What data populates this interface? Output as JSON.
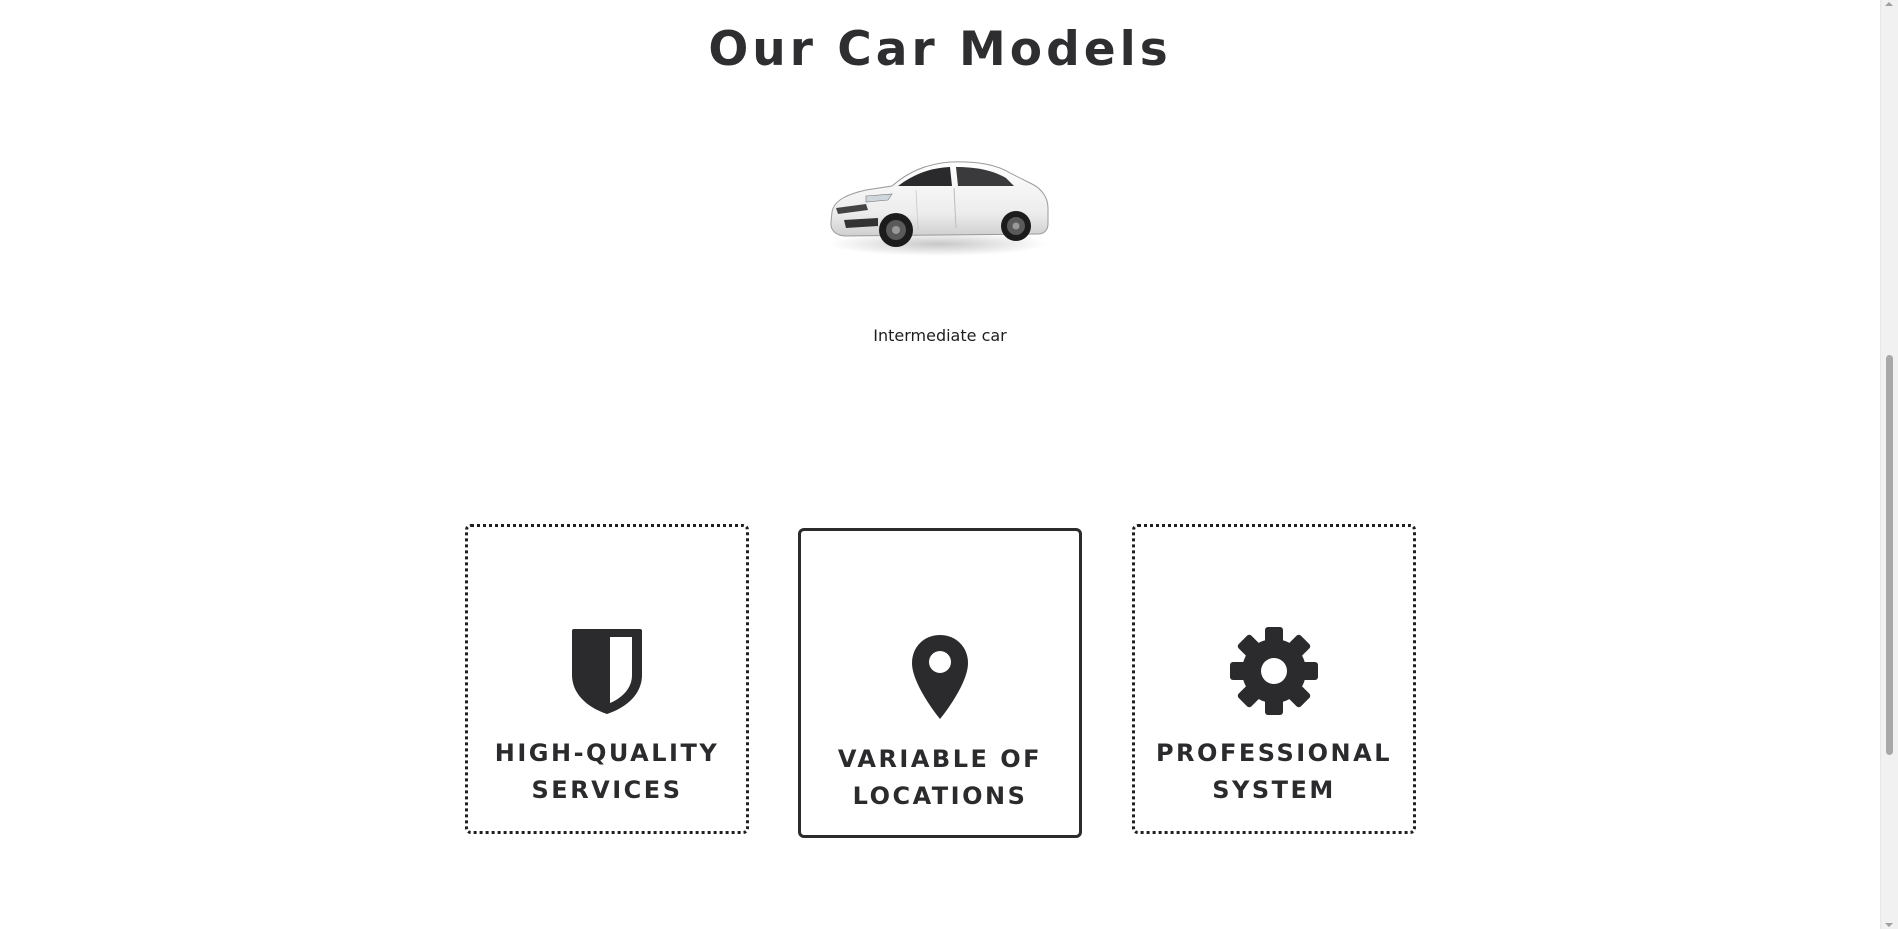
{
  "section": {
    "title": "Our Car Models"
  },
  "car": {
    "caption": "Intermediate car",
    "image_icon": "white-hatchback-car"
  },
  "features": [
    {
      "label_line1": "HIGH-QUALITY",
      "label_line2": "SERVICES",
      "icon": "shield-icon"
    },
    {
      "label_line1": "VARIABLE OF",
      "label_line2": "LOCATIONS",
      "icon": "map-pin-icon"
    },
    {
      "label_line1": "PROFESSIONAL",
      "label_line2": "SYSTEM",
      "icon": "gear-icon"
    }
  ],
  "colors": {
    "text": "#2b2b2d",
    "background": "#ffffff",
    "card_border": "#1f1f21"
  }
}
